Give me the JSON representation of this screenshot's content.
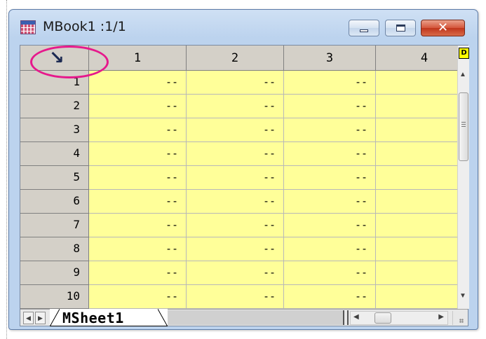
{
  "window": {
    "title": "MBook1 :1/1",
    "buttons": {
      "minimize": "minimize",
      "maximize": "maximize",
      "close": "x"
    }
  },
  "grid": {
    "corner_icon": "↘",
    "columns": [
      "1",
      "2",
      "3",
      "4"
    ],
    "rows": [
      {
        "label": "1",
        "cells": [
          "--",
          "--",
          "--",
          "-"
        ]
      },
      {
        "label": "2",
        "cells": [
          "--",
          "--",
          "--",
          "-"
        ]
      },
      {
        "label": "3",
        "cells": [
          "--",
          "--",
          "--",
          "-"
        ]
      },
      {
        "label": "4",
        "cells": [
          "--",
          "--",
          "--",
          "-"
        ]
      },
      {
        "label": "5",
        "cells": [
          "--",
          "--",
          "--",
          "-"
        ]
      },
      {
        "label": "6",
        "cells": [
          "--",
          "--",
          "--",
          "-"
        ]
      },
      {
        "label": "7",
        "cells": [
          "--",
          "--",
          "--",
          "-"
        ]
      },
      {
        "label": "8",
        "cells": [
          "--",
          "--",
          "--",
          "-"
        ]
      },
      {
        "label": "9",
        "cells": [
          "--",
          "--",
          "--",
          "-"
        ]
      },
      {
        "label": "10",
        "cells": [
          "--",
          "--",
          "--",
          "-"
        ]
      }
    ],
    "expand_button": "D"
  },
  "sheets": {
    "active_tab": "MSheet1"
  },
  "colors": {
    "cell_background": "#ffff99",
    "header_background": "#d4d0c8",
    "highlight_ring": "#e6198c",
    "close_button": "#c0361c"
  },
  "icons": {
    "corner": "select-all-arrow-icon",
    "nav_prev": "triangle-left-icon",
    "nav_next": "triangle-right-icon"
  }
}
